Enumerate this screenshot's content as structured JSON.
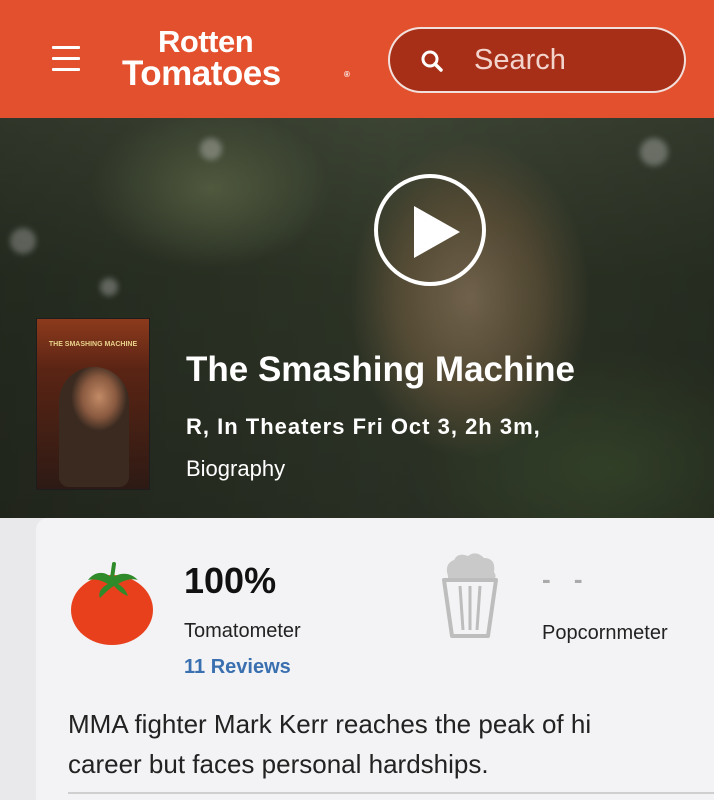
{
  "header": {
    "logo_line1": "Rotten",
    "logo_line2": "Tomatoes",
    "search_placeholder": "Search",
    "brand_color": "#e3502d"
  },
  "hero": {
    "poster_title": "THE SMASHING MACHINE",
    "title": "The Smashing Machine",
    "meta_line1": "R, In Theaters Fri Oct 3, 2h 3m,",
    "meta_line2": "Biography"
  },
  "scores": {
    "tomatometer_value": "100%",
    "tomatometer_label": "Tomatometer",
    "reviews_link": "11 Reviews",
    "popcornmeter_value": "- -",
    "popcornmeter_label": "Popcornmeter"
  },
  "synopsis": {
    "line1": "MMA fighter Mark Kerr reaches the peak of hi",
    "line2": "career but faces personal hardships."
  },
  "icons": [
    "menu-icon",
    "search-icon",
    "play-icon",
    "tomato-icon",
    "popcorn-icon"
  ]
}
